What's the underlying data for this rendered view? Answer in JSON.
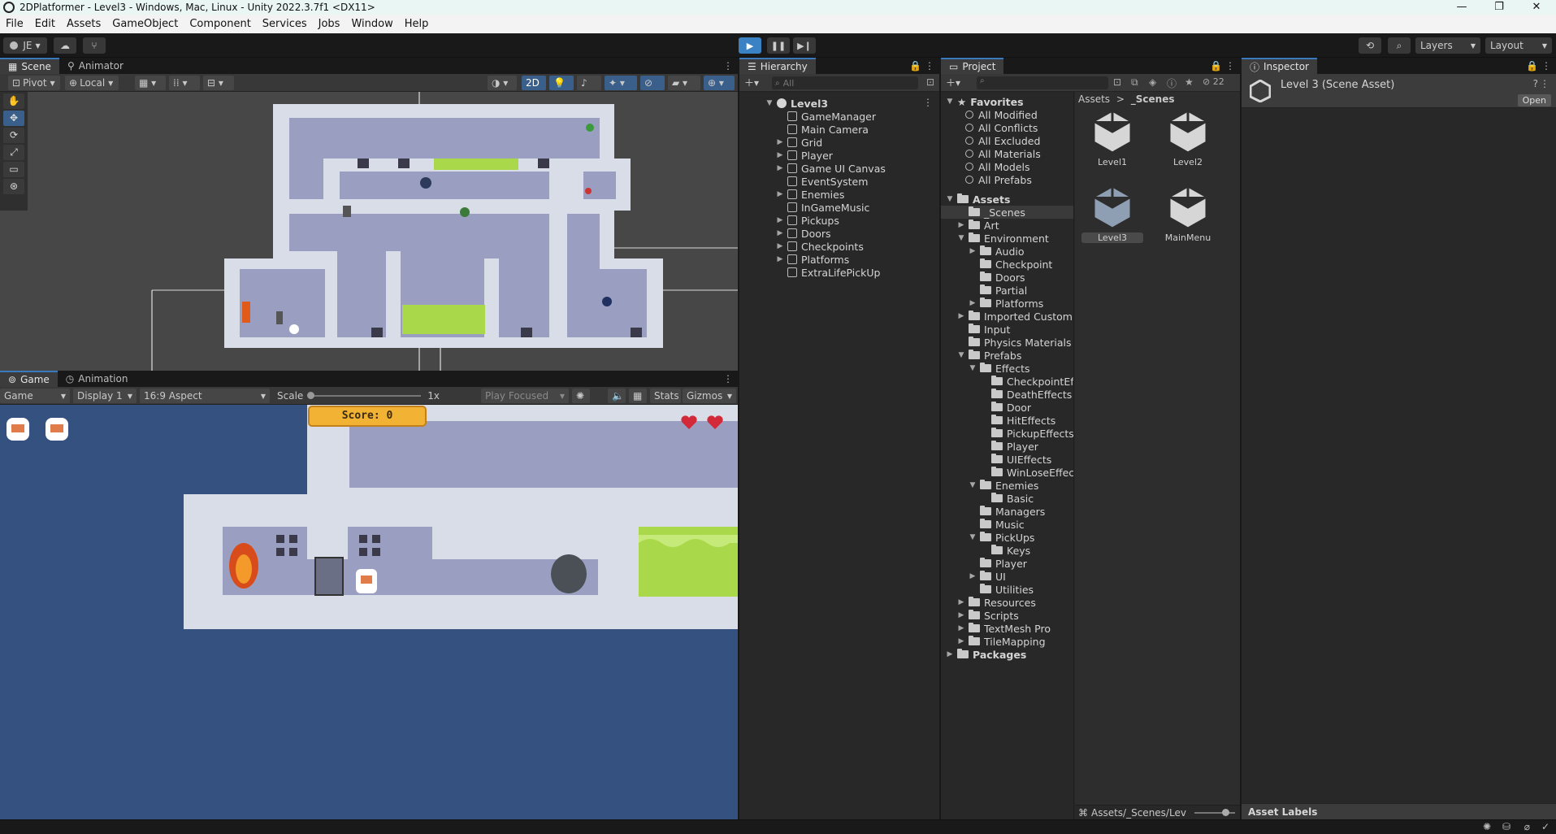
{
  "window": {
    "title": "2DPlatformer - Level3 - Windows, Mac, Linux - Unity 2022.3.7f1 <DX11>",
    "minimize": "—",
    "maximize": "❐",
    "close": "✕"
  },
  "menu": [
    "File",
    "Edit",
    "Assets",
    "GameObject",
    "Component",
    "Services",
    "Jobs",
    "Window",
    "Help"
  ],
  "toolbar": {
    "account": "JE",
    "layers": "Layers",
    "layout": "Layout"
  },
  "scene": {
    "tabs": [
      "Scene",
      "Animator"
    ],
    "pivot": "Pivot",
    "local": "Local",
    "mode_2d": "2D"
  },
  "game": {
    "tabs": [
      "Game",
      "Animation"
    ],
    "game_dropdown": "Game",
    "display": "Display 1",
    "aspect": "16:9 Aspect",
    "scale_label": "Scale",
    "scale_value": "1x",
    "play_focused": "Play Focused",
    "stats": "Stats",
    "gizmos": "Gizmos",
    "score": "Score: 0"
  },
  "hierarchy": {
    "tab": "Hierarchy",
    "search_placeholder": "All",
    "scene_name": "Level3",
    "items": [
      {
        "label": "GameManager",
        "expandable": false
      },
      {
        "label": "Main Camera",
        "expandable": false
      },
      {
        "label": "Grid",
        "expandable": true
      },
      {
        "label": "Player",
        "expandable": true
      },
      {
        "label": "Game UI Canvas",
        "expandable": true
      },
      {
        "label": "EventSystem",
        "expandable": false
      },
      {
        "label": "Enemies",
        "expandable": true
      },
      {
        "label": "InGameMusic",
        "expandable": false
      },
      {
        "label": "Pickups",
        "expandable": true
      },
      {
        "label": "Doors",
        "expandable": true
      },
      {
        "label": "Checkpoints",
        "expandable": true
      },
      {
        "label": "Platforms",
        "expandable": true
      },
      {
        "label": "ExtraLifePickUp",
        "expandable": false
      }
    ]
  },
  "project": {
    "tab": "Project",
    "hidden_count": "22",
    "favorites_label": "Favorites",
    "favorites": [
      "All Modified",
      "All Conflicts",
      "All Excluded",
      "All Materials",
      "All Models",
      "All Prefabs"
    ],
    "tree": [
      {
        "label": "Assets",
        "depth": 0,
        "arrow": "open",
        "bold": true
      },
      {
        "label": "_Scenes",
        "depth": 1,
        "arrow": "none",
        "selected": true
      },
      {
        "label": "Art",
        "depth": 1,
        "arrow": "closed"
      },
      {
        "label": "Environment",
        "depth": 1,
        "arrow": "open"
      },
      {
        "label": "Audio",
        "depth": 2,
        "arrow": "closed"
      },
      {
        "label": "Checkpoint",
        "depth": 2,
        "arrow": "none"
      },
      {
        "label": "Doors",
        "depth": 2,
        "arrow": "none"
      },
      {
        "label": "Partial",
        "depth": 2,
        "arrow": "none"
      },
      {
        "label": "Platforms",
        "depth": 2,
        "arrow": "closed"
      },
      {
        "label": "Imported Custom Ass",
        "depth": 1,
        "arrow": "closed"
      },
      {
        "label": "Input",
        "depth": 1,
        "arrow": "none"
      },
      {
        "label": "Physics Materials",
        "depth": 1,
        "arrow": "none"
      },
      {
        "label": "Prefabs",
        "depth": 1,
        "arrow": "open"
      },
      {
        "label": "Effects",
        "depth": 2,
        "arrow": "open"
      },
      {
        "label": "CheckpointEffe",
        "depth": 3,
        "arrow": "none"
      },
      {
        "label": "DeathEffects",
        "depth": 3,
        "arrow": "none"
      },
      {
        "label": "Door",
        "depth": 3,
        "arrow": "none"
      },
      {
        "label": "HitEffects",
        "depth": 3,
        "arrow": "none"
      },
      {
        "label": "PickupEffects",
        "depth": 3,
        "arrow": "none"
      },
      {
        "label": "Player",
        "depth": 3,
        "arrow": "none"
      },
      {
        "label": "UIEffects",
        "depth": 3,
        "arrow": "none"
      },
      {
        "label": "WinLoseEffects",
        "depth": 3,
        "arrow": "none"
      },
      {
        "label": "Enemies",
        "depth": 2,
        "arrow": "open"
      },
      {
        "label": "Basic",
        "depth": 3,
        "arrow": "none"
      },
      {
        "label": "Managers",
        "depth": 2,
        "arrow": "none"
      },
      {
        "label": "Music",
        "depth": 2,
        "arrow": "none"
      },
      {
        "label": "PickUps",
        "depth": 2,
        "arrow": "open"
      },
      {
        "label": "Keys",
        "depth": 3,
        "arrow": "none"
      },
      {
        "label": "Player",
        "depth": 2,
        "arrow": "none"
      },
      {
        "label": "UI",
        "depth": 2,
        "arrow": "closed"
      },
      {
        "label": "Utilities",
        "depth": 2,
        "arrow": "none"
      },
      {
        "label": "Resources",
        "depth": 1,
        "arrow": "closed"
      },
      {
        "label": "Scripts",
        "depth": 1,
        "arrow": "closed"
      },
      {
        "label": "TextMesh Pro",
        "depth": 1,
        "arrow": "closed"
      },
      {
        "label": "TileMapping",
        "depth": 1,
        "arrow": "closed"
      },
      {
        "label": "Packages",
        "depth": 0,
        "arrow": "closed",
        "bold": true
      }
    ],
    "breadcrumb": [
      "Assets",
      "_Scenes"
    ],
    "assets": [
      "Level1",
      "Level2",
      "Level3",
      "MainMenu"
    ],
    "selected_asset": "Level3",
    "path": "Assets/_Scenes/Lev"
  },
  "inspector": {
    "tab": "Inspector",
    "title": "Level 3 (Scene Asset)",
    "open_button": "Open",
    "asset_labels": "Asset Labels"
  },
  "colors": {
    "accent": "#3a79bb",
    "game_bg": "#355180",
    "level_wall": "#d9dde8",
    "level_room": "#9a9fc2"
  }
}
